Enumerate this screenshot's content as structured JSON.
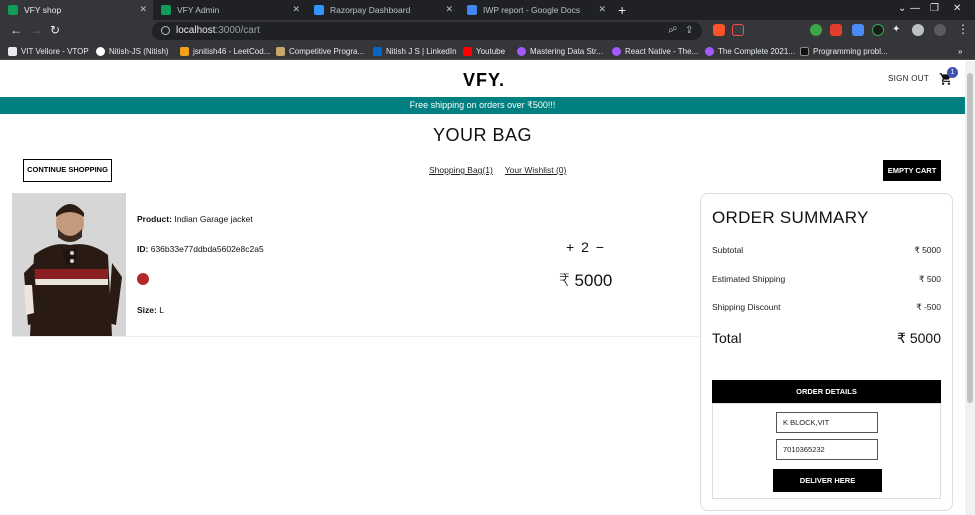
{
  "browser": {
    "tabs": [
      {
        "title": "VFY shop",
        "active": true,
        "favicon_color": "#1a73e8"
      },
      {
        "title": "VFY Admin",
        "active": false,
        "favicon_color": "#1a73e8"
      },
      {
        "title": "Razorpay Dashboard",
        "active": false,
        "favicon_color": "#3395ff"
      },
      {
        "title": "IWP report - Google Docs",
        "active": false,
        "favicon_color": "#4285f4"
      }
    ],
    "url_host": "localhost",
    "url_path": ":3000/cart",
    "bookmarks": [
      {
        "label": "VIT Vellore - VTOP",
        "color": "#e8eaed"
      },
      {
        "label": "Nitish-JS (Nitish)",
        "color": "#ffffff"
      },
      {
        "label": "jsnitish46 - LeetCod...",
        "color": "#f89f1b"
      },
      {
        "label": "Competitive Progra...",
        "color": "#c9a66b"
      },
      {
        "label": "Nitish J S | LinkedIn",
        "color": "#0a66c2"
      },
      {
        "label": "Youtube",
        "color": "#ff0000"
      },
      {
        "label": "Mastering Data Str...",
        "color": "#a259ff"
      },
      {
        "label": "React Native - The...",
        "color": "#a259ff"
      },
      {
        "label": "The Complete 2021...",
        "color": "#a259ff"
      },
      {
        "label": "Programming probl...",
        "color": "#111111"
      }
    ]
  },
  "header": {
    "logo": "VFY.",
    "sign_out": "SIGN OUT",
    "cart_count": "1"
  },
  "announcement": "Free shipping on orders over ₹500!!!",
  "cart": {
    "title": "YOUR BAG",
    "continue_label": "CONTINUE SHOPPING",
    "shopping_bag_link": "Shopping Bag(1)",
    "wishlist_link": "Your Wishlist (0)",
    "empty_label": "EMPTY CART",
    "product": {
      "name_label": "Product:",
      "name": "Indian Garage jacket",
      "id_label": "ID:",
      "id": "636b33e77ddbda5602e8c2a5",
      "color": "#b02a2a",
      "size_label": "Size:",
      "size": "L",
      "qty_plus": "+",
      "quantity": "2",
      "qty_minus": "−",
      "price": "₹ 5000"
    }
  },
  "summary": {
    "title": "ORDER SUMMARY",
    "rows": [
      {
        "label": "Subtotal",
        "value": "₹ 5000"
      },
      {
        "label": "Estimated Shipping",
        "value": "₹ 500"
      },
      {
        "label": "Shipping Discount",
        "value": "₹ -500"
      }
    ],
    "total_label": "Total",
    "total_value": "₹ 5000",
    "order_details_label": "ORDER DETAILS",
    "address": "K BLOCK,VIT UNIVERSITY",
    "phone": "7010365232",
    "deliver_label": "DELIVER HERE"
  },
  "colors": {
    "accent_teal": "#008080",
    "primary_black": "#000000"
  }
}
